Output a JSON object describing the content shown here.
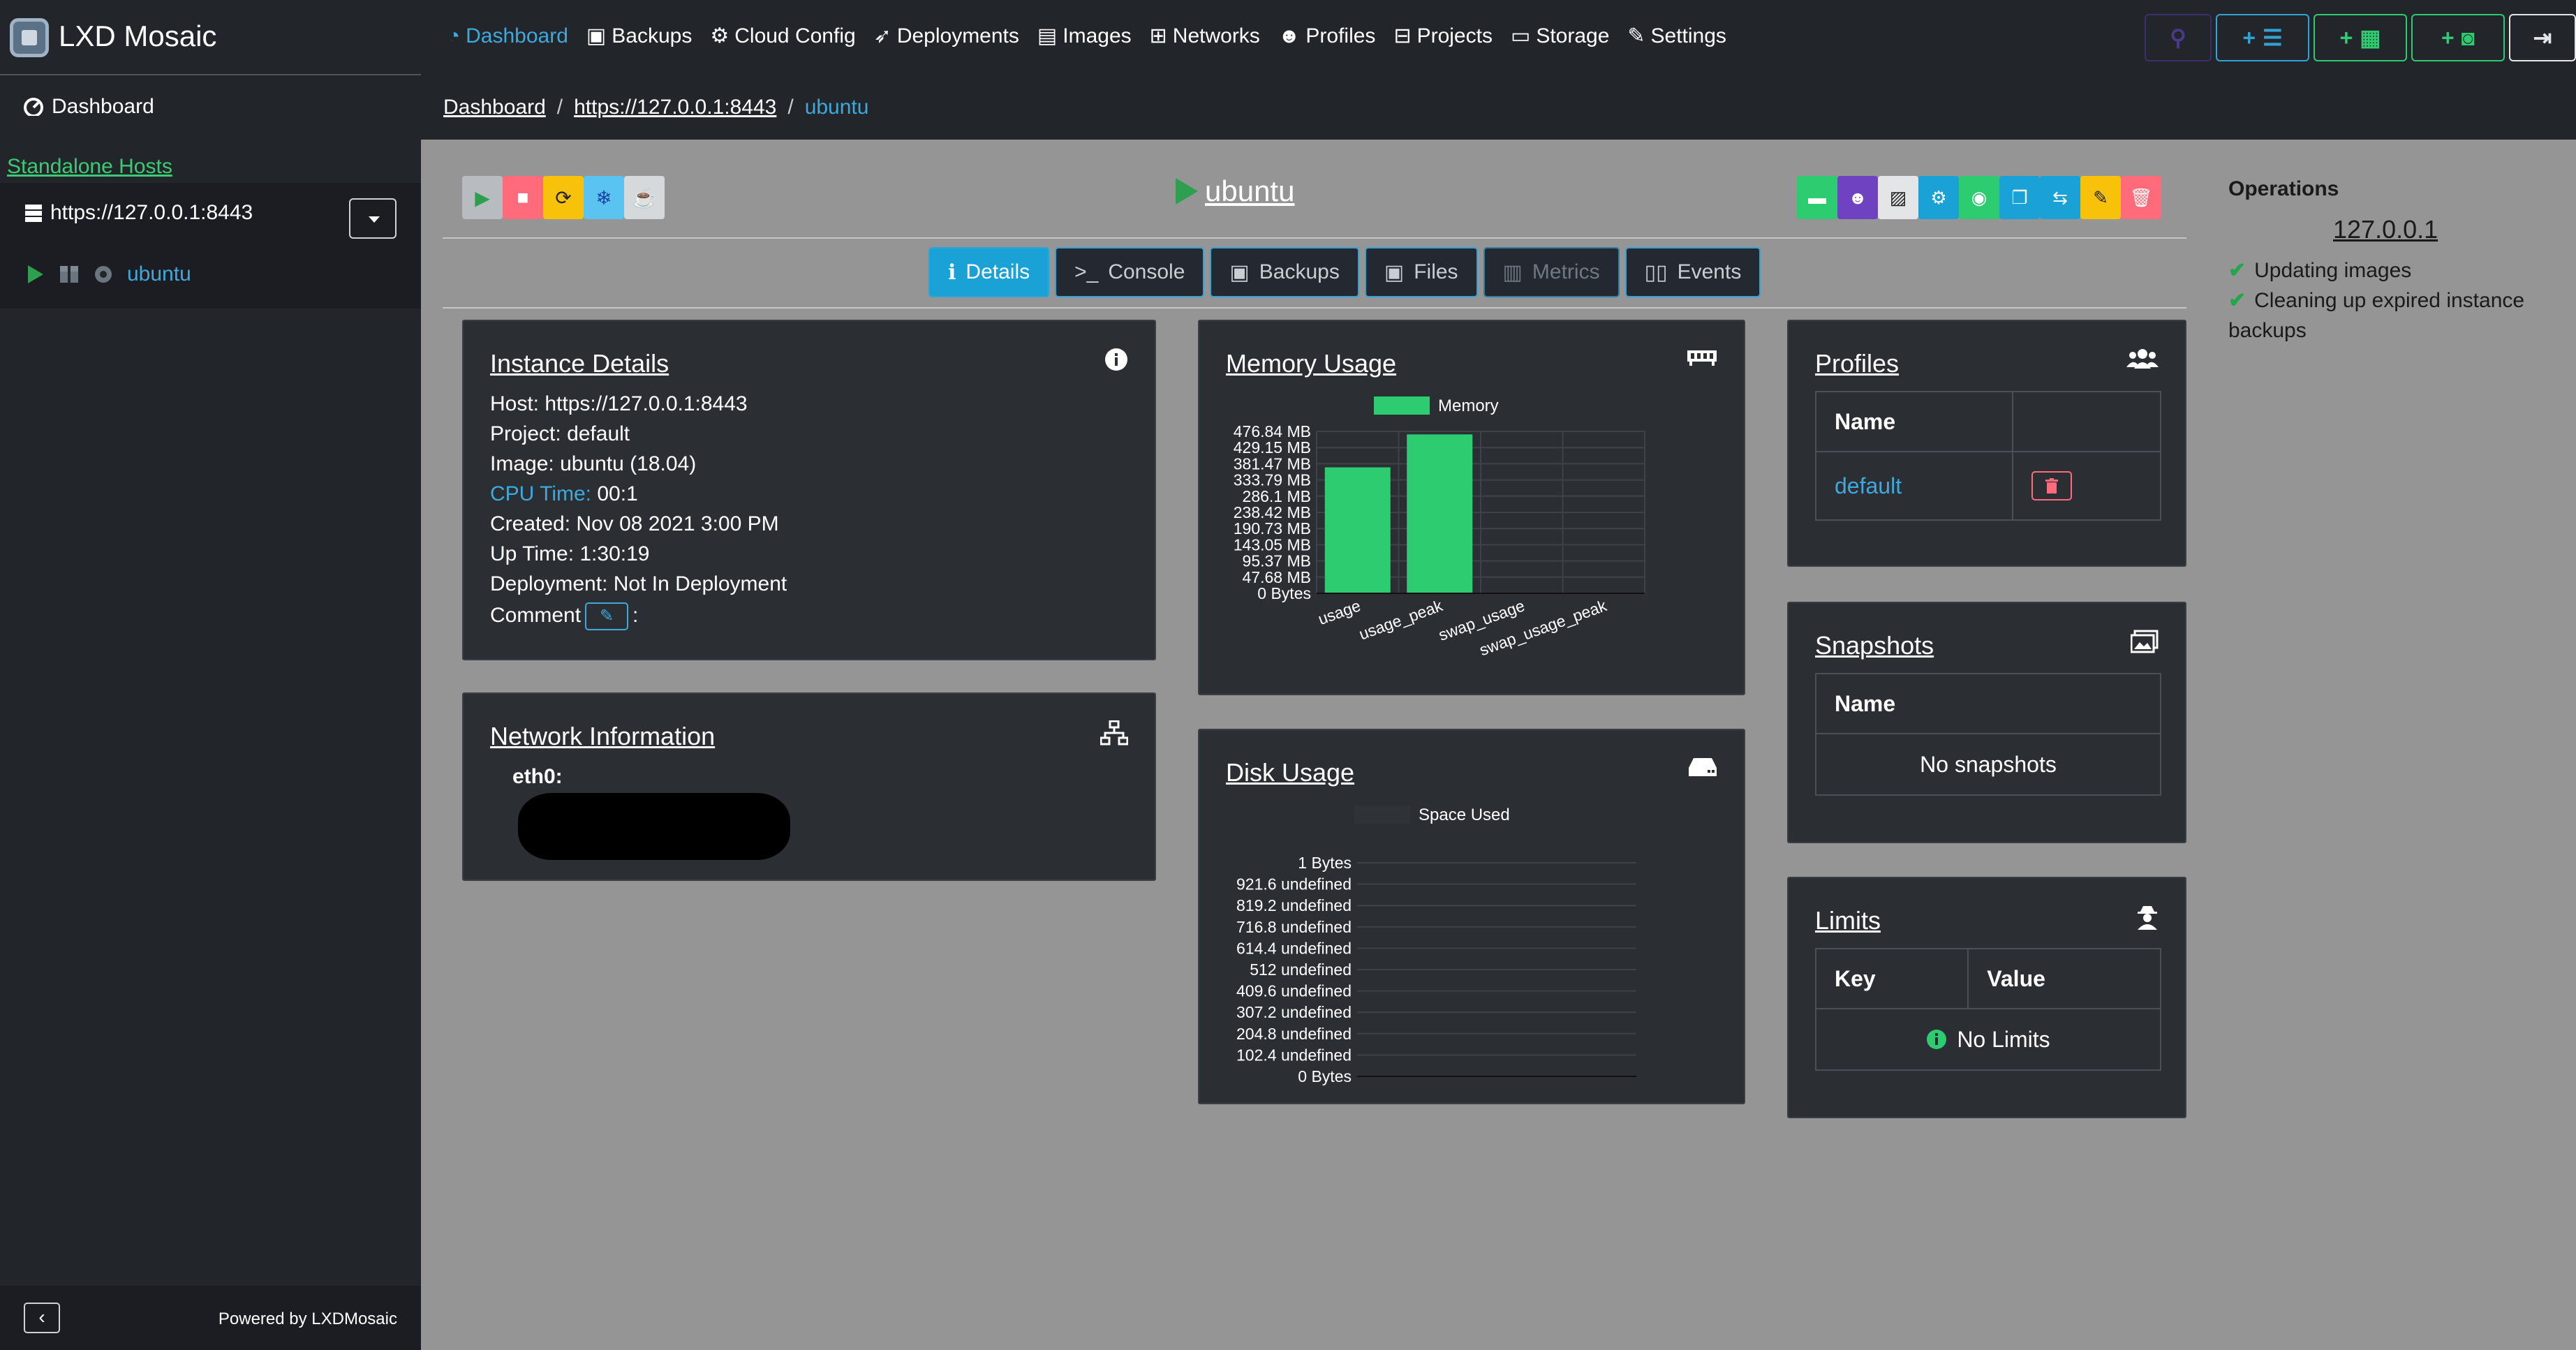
{
  "app": {
    "title": "LXD Mosaic",
    "powered_by": "Powered by LXDMosaic"
  },
  "sidebar": {
    "dashboard_label": "Dashboard",
    "section_label": "Standalone Hosts",
    "host_label": "https://127.0.0.1:8443",
    "instance_label": "ubuntu"
  },
  "nav": {
    "items": [
      {
        "label": "Dashboard",
        "icon": "dashboard-icon"
      },
      {
        "label": "Backups",
        "icon": "save-icon"
      },
      {
        "label": "Cloud Config",
        "icon": "cogs-icon"
      },
      {
        "label": "Deployments",
        "icon": "rocket-icon"
      },
      {
        "label": "Images",
        "icon": "images-icon"
      },
      {
        "label": "Networks",
        "icon": "network-icon"
      },
      {
        "label": "Profiles",
        "icon": "users-icon"
      },
      {
        "label": "Projects",
        "icon": "project-diagram-icon"
      },
      {
        "label": "Storage",
        "icon": "hdd-icon"
      },
      {
        "label": "Settings",
        "icon": "wrench-icon"
      }
    ],
    "active": "Dashboard"
  },
  "breadcrumb": {
    "items": [
      "Dashboard",
      "https://127.0.0.1:8443",
      "ubuntu"
    ],
    "separator": "/"
  },
  "instance": {
    "name": "ubuntu"
  },
  "tabs": [
    {
      "label": "Details",
      "icon": "info-icon",
      "state": "active"
    },
    {
      "label": "Console",
      "icon": "terminal-icon",
      "state": "normal"
    },
    {
      "label": "Backups",
      "icon": "save-icon",
      "state": "normal"
    },
    {
      "label": "Files",
      "icon": "save-icon",
      "state": "normal"
    },
    {
      "label": "Metrics",
      "icon": "chart-icon",
      "state": "disabled"
    },
    {
      "label": "Events",
      "icon": "book-icon",
      "state": "normal"
    }
  ],
  "details": {
    "title": "Instance Details",
    "host_label": "Host:",
    "host_value": "https://127.0.0.1:8443",
    "project_label": "Project:",
    "project_value": "default",
    "image_label": "Image:",
    "image_value": "ubuntu (18.04)",
    "cpu_label": "CPU Time:",
    "cpu_value": "00:1",
    "created_label": "Created:",
    "created_value": "Nov 08 2021 3:00 PM",
    "uptime_label": "Up Time:",
    "uptime_value": "1:30:19",
    "deployment_label": "Deployment:",
    "deployment_value": "Not In Deployment",
    "comment_label": "Comment",
    "comment_suffix": ":"
  },
  "network": {
    "title": "Network Information",
    "iface": "eth0:"
  },
  "memory": {
    "title": "Memory Usage"
  },
  "disk": {
    "title": "Disk Usage"
  },
  "profiles": {
    "title": "Profiles",
    "col_name": "Name",
    "rows": [
      "default"
    ]
  },
  "snapshots": {
    "title": "Snapshots",
    "col_name": "Name",
    "empty": "No snapshots"
  },
  "limits": {
    "title": "Limits",
    "col_key": "Key",
    "col_value": "Value",
    "empty": "No Limits"
  },
  "operations": {
    "title": "Operations",
    "host": "127.0.0.1",
    "items": [
      "Updating images",
      "Cleaning up expired instance backups"
    ]
  },
  "colors": {
    "accent": "#1aa1d6",
    "green": "#2ecc71",
    "danger": "#ff6b7a"
  },
  "chart_data": [
    {
      "type": "bar",
      "title": "",
      "legend": [
        "Memory"
      ],
      "categories": [
        "usage",
        "usage_peak",
        "swap_usage",
        "swap_usage_peak"
      ],
      "series": [
        {
          "name": "Memory",
          "values": [
            371,
            468,
            0,
            0
          ]
        }
      ],
      "value_unit": "MB",
      "ylim": [
        0,
        476.84
      ],
      "yticks": [
        "476.84 MB",
        "429.15 MB",
        "381.47 MB",
        "333.79 MB",
        "286.1 MB",
        "238.42 MB",
        "190.73 MB",
        "143.05 MB",
        "95.37 MB",
        "47.68 MB",
        "0 Bytes"
      ],
      "grid": true
    },
    {
      "type": "bar",
      "title": "",
      "legend": [
        "Space Used"
      ],
      "categories": [],
      "series": [
        {
          "name": "Space Used",
          "values": []
        }
      ],
      "yticks": [
        "1 Bytes",
        "921.6 undefined",
        "819.2 undefined",
        "716.8 undefined",
        "614.4 undefined",
        "512 undefined",
        "409.6 undefined",
        "307.2 undefined",
        "204.8 undefined",
        "102.4 undefined",
        "0 Bytes"
      ],
      "grid": true
    }
  ]
}
